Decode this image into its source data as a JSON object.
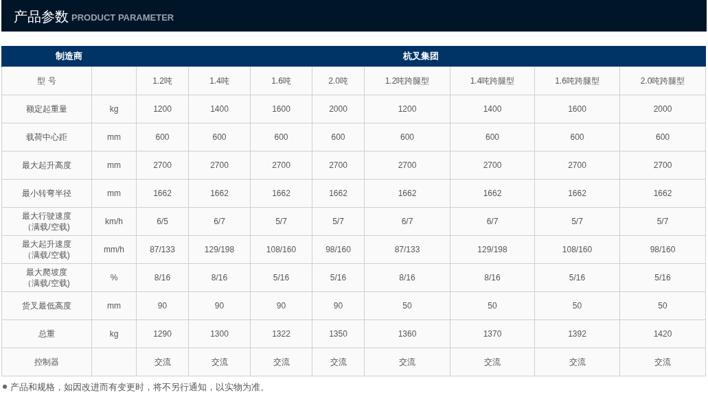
{
  "title_bar": {
    "title": "产品参数",
    "subtitle": "PRODUCT PARAMETER"
  },
  "table": {
    "header": [
      "制造商",
      "杭叉集团"
    ],
    "rows": [
      {
        "label": [
          "型 号"
        ],
        "unit": "",
        "values": [
          "1.2吨",
          "1.4吨",
          "1.6吨",
          "2.0吨",
          "1.2吨跨腿型",
          "1.4吨跨腿型",
          "1.6吨跨腿型",
          "2.0吨跨腿型"
        ]
      },
      {
        "label": [
          "额定起重量"
        ],
        "unit": "kg",
        "values": [
          "1200",
          "1400",
          "1600",
          "2000",
          "1200",
          "1400",
          "1600",
          "2000"
        ]
      },
      {
        "label": [
          "载荷中心距"
        ],
        "unit": "mm",
        "values": [
          "600",
          "600",
          "600",
          "600",
          "600",
          "600",
          "600",
          "600"
        ]
      },
      {
        "label": [
          "最大起升高度"
        ],
        "unit": "mm",
        "values": [
          "2700",
          "2700",
          "2700",
          "2700",
          "2700",
          "2700",
          "2700",
          "2700"
        ]
      },
      {
        "label": [
          "最小转弯半径"
        ],
        "unit": "mm",
        "values": [
          "1662",
          "1662",
          "1662",
          "1662",
          "1662",
          "1662",
          "1662",
          "1662"
        ]
      },
      {
        "label": [
          "最大行驶速度",
          "（满载/空载)"
        ],
        "unit": "km/h",
        "values": [
          "6/5",
          "6/7",
          "5/7",
          "5/7",
          "6/7",
          "6/7",
          "5/7",
          "5/7"
        ]
      },
      {
        "label": [
          "最大起升速度",
          "（满载/空载)"
        ],
        "unit": "mm/h",
        "values": [
          "87/133",
          "129/198",
          "108/160",
          "98/160",
          "87/133",
          "129/198",
          "108/160",
          "98/160"
        ]
      },
      {
        "label": [
          "最大爬坡度",
          "（满载/空载)"
        ],
        "unit": "%",
        "values": [
          "8/16",
          "8/16",
          "5/16",
          "5/16",
          "8/16",
          "8/16",
          "5/16",
          "5/16"
        ]
      },
      {
        "label": [
          "货叉最低高度"
        ],
        "unit": "mm",
        "values": [
          "90",
          "90",
          "90",
          "90",
          "50",
          "50",
          "50",
          "50"
        ]
      },
      {
        "label": [
          "总重"
        ],
        "unit": "kg",
        "values": [
          "1290",
          "1300",
          "1322",
          "1350",
          "1360",
          "1370",
          "1392",
          "1420"
        ]
      },
      {
        "label": [
          "控制器"
        ],
        "unit": "",
        "values": [
          "交流",
          "交流",
          "交流",
          "交流",
          "交流",
          "交流",
          "交流",
          "交流"
        ]
      }
    ]
  },
  "note": "产品和规格，如因改进而有变更时，将不另行通知，以实物为准。"
}
